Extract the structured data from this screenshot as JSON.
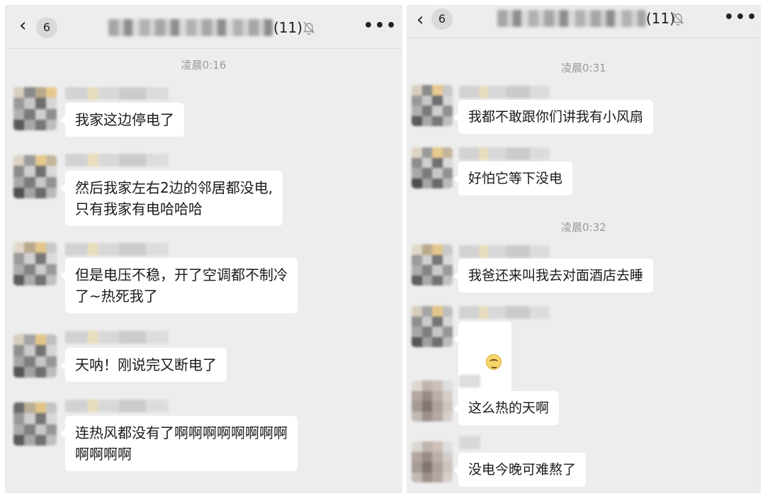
{
  "left": {
    "header": {
      "back_icon": "chevron-left-icon",
      "unread_count": "6",
      "member_count": "(11)",
      "mute_icon": "bell-slash-icon",
      "more_label": "•••"
    },
    "time_label": "凌晨0:16",
    "messages": [
      {
        "text": "我家这边停电了"
      },
      {
        "text": "然后我家左右2边的邻居都没电,\n只有我家有电哈哈哈"
      },
      {
        "text": "但是电压不稳，开了空调都不制冷\n了~热死我了"
      },
      {
        "text": "天呐！刚说完又断电了"
      },
      {
        "text": "连热风都没有了啊啊啊啊啊啊啊啊\n啊啊啊啊"
      }
    ]
  },
  "right": {
    "header": {
      "back_icon": "chevron-left-icon",
      "unread_count": "6",
      "member_count": "(11)",
      "mute_icon": "bell-slash-icon",
      "more_label": "•••"
    },
    "time_labels": [
      "凌晨0:31",
      "凌晨0:32"
    ],
    "messages": [
      {
        "text": "我都不敢跟你们讲我有小风扇"
      },
      {
        "text": "好怕它等下没电"
      },
      {
        "text": "我爸还来叫我去对面酒店去睡"
      },
      {
        "emoji": "smiling-face-emoji"
      },
      {
        "text": "这么热的天啊"
      },
      {
        "text": "没电今晚可难熬了"
      }
    ]
  },
  "colors": {
    "background": "#ededed",
    "bubble": "#ffffff",
    "timestamp": "#9a9a9a"
  }
}
